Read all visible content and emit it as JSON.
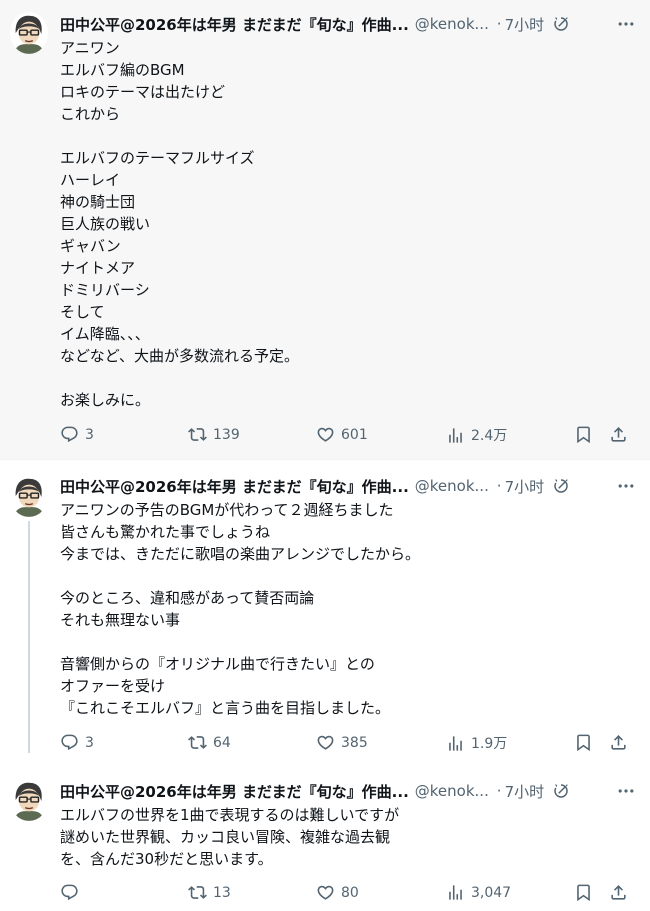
{
  "tweets": [
    {
      "name": "田中公平@2026年は年男 まだまだ『旬な』作曲...",
      "handle": "@kenok...",
      "separator": "·",
      "time": "7小时",
      "lines": [
        "アニワン",
        "エルバフ編のBGM",
        "ロキのテーマは出たけど",
        "これから",
        "",
        "エルバフのテーマフルサイズ",
        "ハーレイ",
        "神の騎士団",
        "巨人族の戦い",
        "ギャバン",
        "ナイトメア",
        "ドミリバーシ",
        "そして",
        "イム降臨、、、",
        "などなど、大曲が多数流れる予定。",
        "",
        "お楽しみに。"
      ],
      "stats": {
        "replies": "3",
        "retweets": "139",
        "likes": "601",
        "views": "2.4万"
      }
    },
    {
      "name": "田中公平@2026年は年男 まだまだ『旬な』作曲...",
      "handle": "@kenok...",
      "separator": "·",
      "time": "7小时",
      "lines": [
        "アニワンの予告のBGMが代わって２週経ちました",
        "皆さんも驚かれた事でしょうね",
        "今までは、きただに歌唱の楽曲アレンジでしたから。",
        "",
        "今のところ、違和感があって賛否両論",
        "それも無理ない事",
        "",
        "音響側からの『オリジナル曲で行きたい』との",
        "オファーを受け",
        "『これこそエルバフ』と言う曲を目指しました。"
      ],
      "stats": {
        "replies": "3",
        "retweets": "64",
        "likes": "385",
        "views": "1.9万"
      }
    },
    {
      "name": "田中公平@2026年は年男 まだまだ『旬な』作曲...",
      "handle": "@kenok...",
      "separator": "·",
      "time": "7小时",
      "lines": [
        "エルバフの世界を1曲で表現するのは難しいですが",
        "謎めいた世界観、カッコ良い冒険、複雑な過去観",
        "を、含んだ30秒だと思います。"
      ],
      "stats": {
        "replies": "",
        "retweets": "13",
        "likes": "80",
        "views": "3,047"
      }
    }
  ],
  "icons": {
    "reply": "reply-icon",
    "retweet": "retweet-icon",
    "like": "heart-icon",
    "views": "views-chart-icon",
    "bookmark": "bookmark-icon",
    "share": "share-icon",
    "grok": "grok-icon",
    "more": "more-options-icon"
  },
  "colors": {
    "text": "#0f1419",
    "secondary": "#536471",
    "highlight_bg": "#f7f7f7",
    "thread_line": "#cfd9de"
  }
}
